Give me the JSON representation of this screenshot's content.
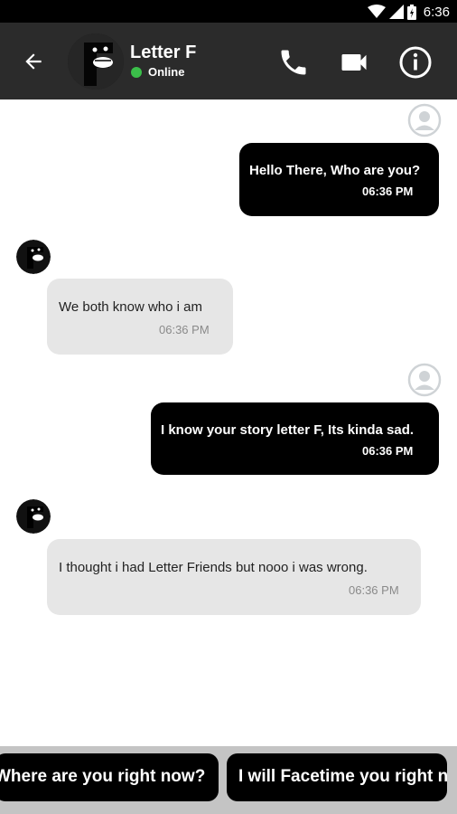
{
  "status_bar": {
    "time": "6:36",
    "icons": [
      "wifi-icon",
      "signal-icon",
      "battery-icon"
    ]
  },
  "header": {
    "back_icon": "arrow-back-icon",
    "contact_name": "Letter F",
    "presence": "Online",
    "presence_color": "#3bbf4a",
    "actions": [
      "phone-icon",
      "videocam-icon",
      "info-icon"
    ]
  },
  "messages": [
    {
      "from": "me",
      "text": "Hello There, Who are you?",
      "time": "06:36 PM"
    },
    {
      "from": "contact",
      "text": "We both know who i am",
      "time": "06:36 PM"
    },
    {
      "from": "me",
      "text": "I know your story letter F, Its kinda sad.",
      "time": "06:36 PM"
    },
    {
      "from": "contact",
      "text": "I thought i had Letter Friends but nooo i was wrong.",
      "time": "06:36 PM"
    }
  ],
  "suggestions": [
    "Where are you right now?",
    "I will Facetime you right now"
  ],
  "colors": {
    "app_bar": "#2b2b2b",
    "sent_bubble": "#000000",
    "received_bubble": "#e6e6e6",
    "suggestion_bar": "#c4c4c4"
  }
}
